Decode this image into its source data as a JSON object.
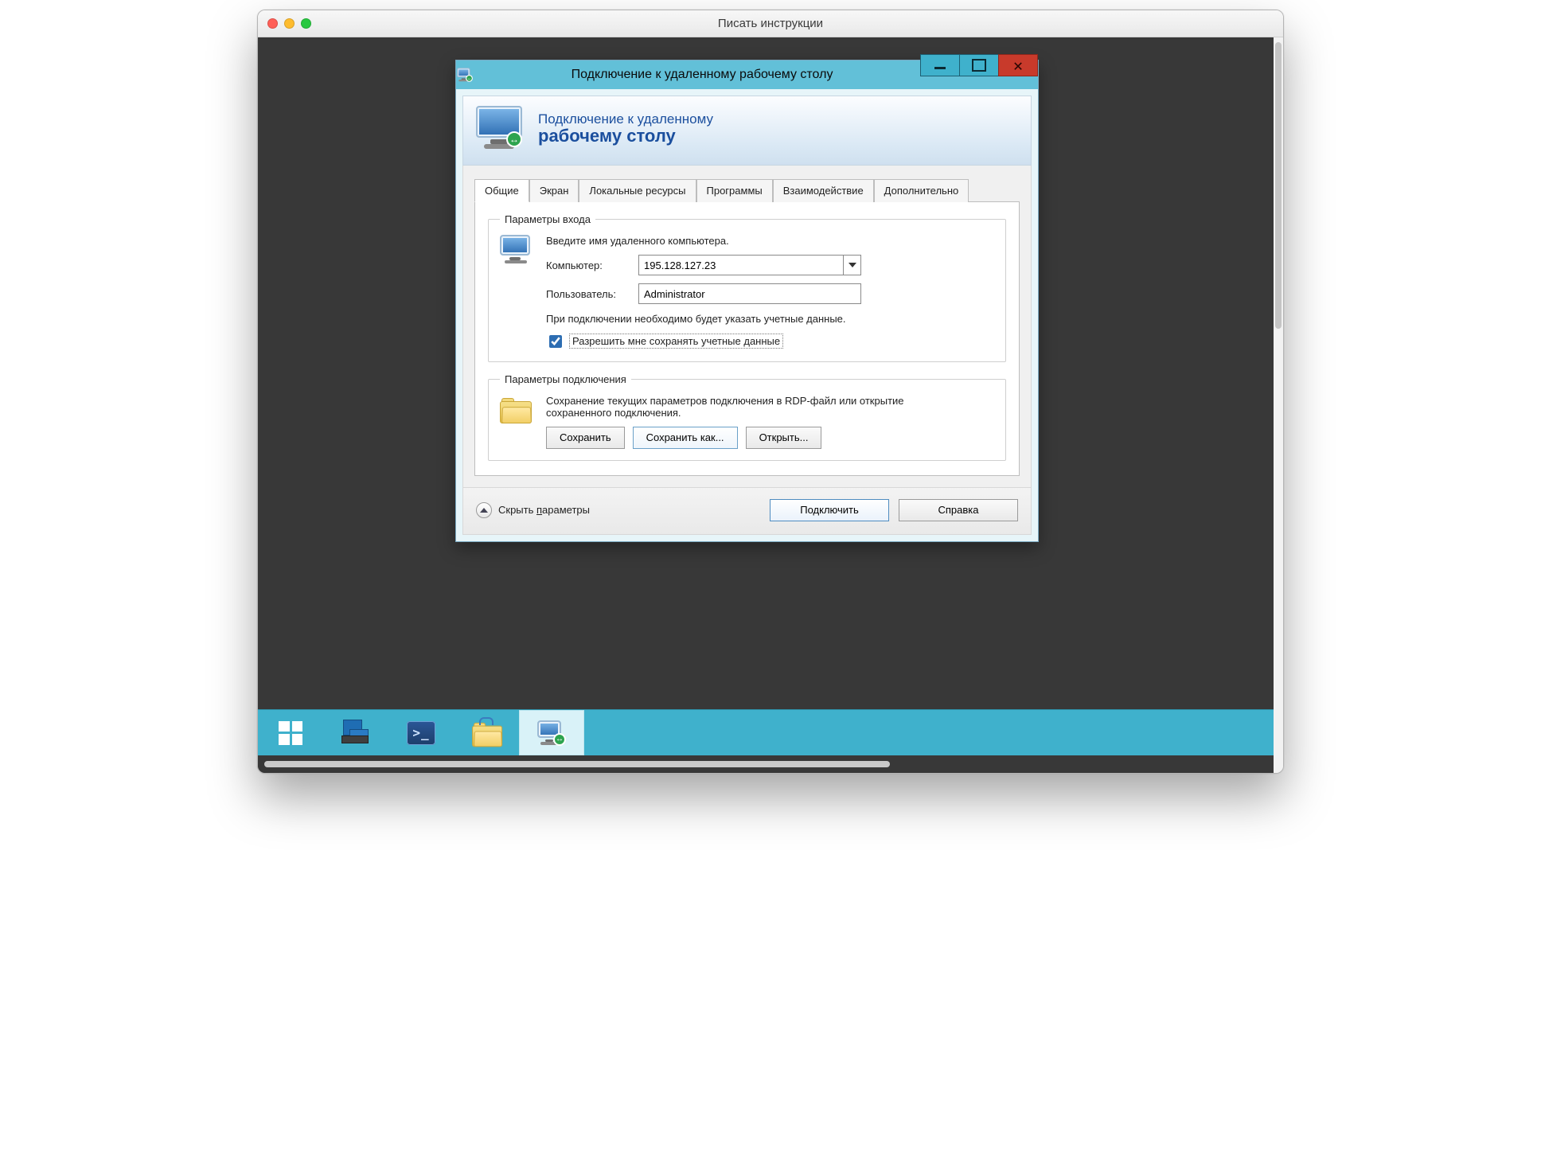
{
  "host_window": {
    "title": "Писать инструкции"
  },
  "rdp": {
    "title": "Подключение к удаленному рабочему столу",
    "banner": {
      "line1": "Подключение к удаленному",
      "line2": "рабочему столу"
    },
    "tabs": [
      "Общие",
      "Экран",
      "Локальные ресурсы",
      "Программы",
      "Взаимодействие",
      "Дополнительно"
    ],
    "active_tab_index": 0,
    "login": {
      "legend": "Параметры входа",
      "intro": "Введите имя удаленного компьютера.",
      "computer_label": "Компьютер:",
      "computer_value": "195.128.127.23",
      "user_label": "Пользователь:",
      "user_value": "Administrator",
      "note": "При подключении необходимо будет указать учетные данные.",
      "save_creds_checked": true,
      "save_creds_label": "Разрешить мне сохранять учетные данные"
    },
    "connection": {
      "legend": "Параметры подключения",
      "desc": "Сохранение текущих параметров подключения в RDP-файл или открытие сохраненного подключения.",
      "save": "Сохранить",
      "save_as": "Сохранить как...",
      "open": "Открыть..."
    },
    "footer": {
      "collapse": "Скрыть параметры",
      "collapse_hint_char": "п",
      "connect": "Подключить",
      "help": "Справка"
    }
  },
  "taskbar": {
    "items": [
      {
        "name": "start",
        "label": "Start"
      },
      {
        "name": "server-manager",
        "label": "Server Manager"
      },
      {
        "name": "powershell",
        "label": "Windows PowerShell"
      },
      {
        "name": "file-explorer",
        "label": "File Explorer"
      },
      {
        "name": "remote-desktop",
        "label": "Remote Desktop Connection",
        "active": true
      }
    ]
  }
}
